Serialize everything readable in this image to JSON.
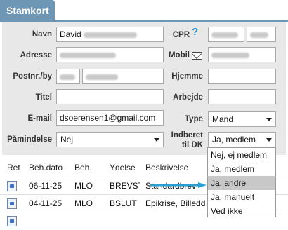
{
  "tab": {
    "title": "Stamkort"
  },
  "form": {
    "navn": {
      "label": "Navn",
      "value": "David"
    },
    "cpr": {
      "label": "CPR"
    },
    "adresse": {
      "label": "Adresse"
    },
    "mobil": {
      "label": "Mobil"
    },
    "postnr": {
      "label": "Postnr./by"
    },
    "hjemme": {
      "label": "Hjemme",
      "value": ""
    },
    "titel": {
      "label": "Titel",
      "value": ""
    },
    "arbejde": {
      "label": "Arbejde",
      "value": ""
    },
    "email": {
      "label": "E-mail",
      "value": "dsoerensen1@gmail.com"
    },
    "type": {
      "label": "Type",
      "value": "Mand"
    },
    "paamindelse": {
      "label": "Påmindelse",
      "value": "Nej"
    },
    "indberet": {
      "label_line1": "Indberet",
      "label_line2": "til DK",
      "value": "Ja, medlem"
    }
  },
  "table": {
    "headers": [
      "Ret",
      "Beh.dato",
      "Beh.",
      "Ydelse",
      "Beskrivelse"
    ],
    "rows": [
      {
        "date": "06-11-25",
        "beh": "MLO",
        "ydelse": "BREVSTI",
        "beskrivelse": "Standardbrev"
      },
      {
        "date": "04-11-25",
        "beh": "MLO",
        "ydelse": "BSLUT",
        "beskrivelse": "Epikrise, Billeddi"
      }
    ]
  },
  "dropdown": {
    "options": [
      "Nej, ej medlem",
      "Ja, medlem",
      "Ja, andre",
      "Ja, manuelt",
      "Ved ikke"
    ],
    "highlighted": "Ja, andre"
  },
  "colors": {
    "tab": "#6e97b5",
    "panel": "#e8e8e8",
    "highlight": "#c8c8c8",
    "arrow": "#2a9fd0"
  }
}
